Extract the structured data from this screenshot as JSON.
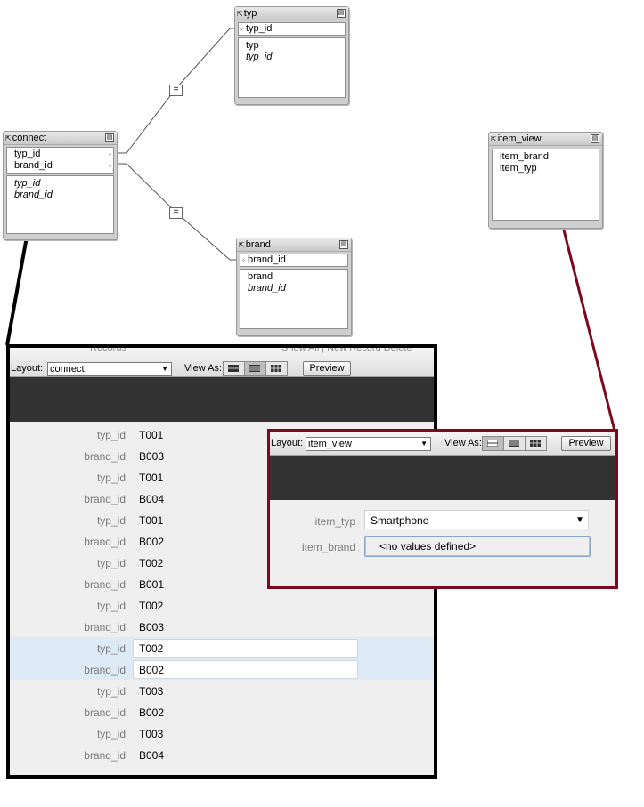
{
  "graph": {
    "typ_table": {
      "name": "typ",
      "keys": [
        "typ_id"
      ],
      "fields": [
        "typ",
        "typ_id"
      ]
    },
    "connect_table": {
      "name": "connect",
      "keys": [
        "typ_id",
        "brand_id"
      ],
      "fields": [
        "typ_id",
        "brand_id"
      ]
    },
    "brand_table": {
      "name": "brand",
      "keys": [
        "brand_id"
      ],
      "fields": [
        "brand",
        "brand_id"
      ]
    },
    "item_view_table": {
      "name": "item_view",
      "fields": [
        "item_brand",
        "item_typ"
      ]
    },
    "join_operator": "="
  },
  "connect_window": {
    "toolbar_fragment_left": "Records",
    "toolbar_fragment_right": "Show All | New Record  Delete",
    "layout_label": "Layout:",
    "layout_value": "connect",
    "view_as_label": "View As:",
    "preview_label": "Preview",
    "field_label_typ": "typ_id",
    "field_label_brand": "brand_id",
    "records": [
      {
        "typ_id": "T001",
        "brand_id": "B003"
      },
      {
        "typ_id": "T001",
        "brand_id": "B004"
      },
      {
        "typ_id": "T001",
        "brand_id": "B002"
      },
      {
        "typ_id": "T002",
        "brand_id": "B001"
      },
      {
        "typ_id": "T002",
        "brand_id": "B003"
      },
      {
        "typ_id": "T002",
        "brand_id": "B002"
      },
      {
        "typ_id": "T003",
        "brand_id": "B002"
      },
      {
        "typ_id": "T003",
        "brand_id": "B004"
      }
    ],
    "active_record_index": 5
  },
  "item_view_window": {
    "layout_label": "Layout:",
    "layout_value": "item_view",
    "view_as_label": "View As:",
    "preview_label": "Preview",
    "item_typ_label": "item_typ",
    "item_typ_value": "Smartphone",
    "item_brand_label": "item_brand",
    "item_brand_value": "<no values defined>"
  },
  "colors": {
    "connect_callout": "#000000",
    "item_view_callout": "#7b0a1e",
    "header_band": "#323232",
    "active_row": "#dfeaf7"
  }
}
